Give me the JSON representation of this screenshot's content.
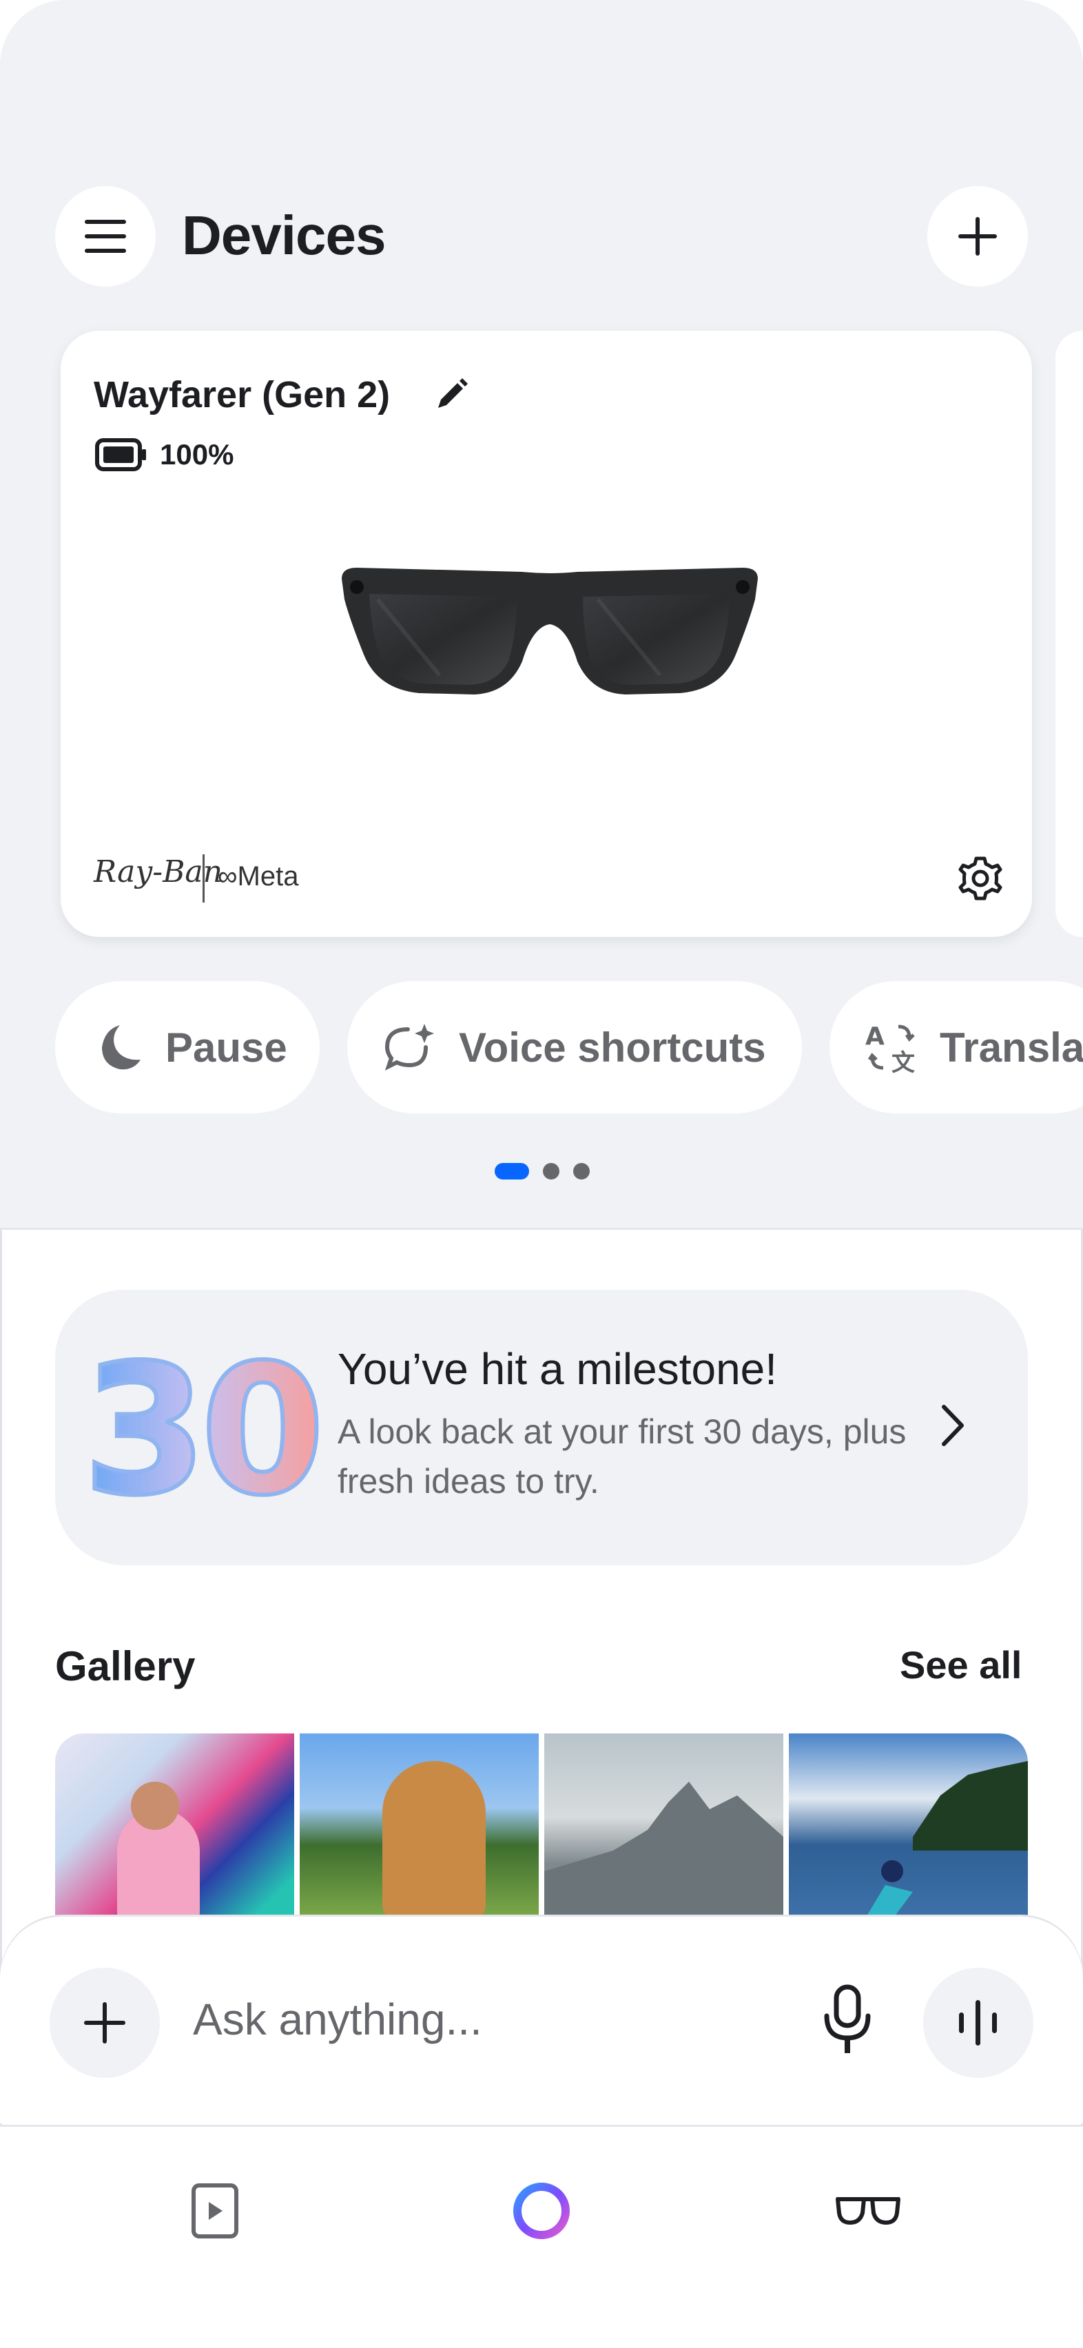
{
  "header": {
    "title": "Devices",
    "menu_icon": "hamburger-menu-icon",
    "add_icon": "plus-icon"
  },
  "device_card": {
    "name": "Wayfarer (Gen 2)",
    "battery": "100%",
    "brand_primary": "Ray-Ban",
    "brand_secondary": "Meta",
    "battery_level": 1.0
  },
  "chips": [
    {
      "label": "Pause",
      "icon": "moon-icon"
    },
    {
      "label": "Voice shortcuts",
      "icon": "voice-shortcuts-icon"
    },
    {
      "label": "Transla",
      "icon": "translate-icon"
    }
  ],
  "pager": {
    "count": 3,
    "active": 0
  },
  "milestone": {
    "number": "30",
    "title": "You’ve hit a milestone!",
    "subtitle": "A look back at your first 30 days, plus fresh ideas to try."
  },
  "gallery": {
    "title": "Gallery",
    "see_all": "See all",
    "items": [
      "mural-photo",
      "dog-photo",
      "mountain-photo",
      "kayak-photo"
    ]
  },
  "composer": {
    "placeholder": "Ask anything..."
  },
  "tabs": [
    {
      "icon": "media-icon"
    },
    {
      "icon": "meta-ai-icon"
    },
    {
      "icon": "glasses-icon"
    }
  ],
  "colors": {
    "accent": "#0866ff",
    "background": "#f0f2f5",
    "text_secondary": "#65676b"
  }
}
